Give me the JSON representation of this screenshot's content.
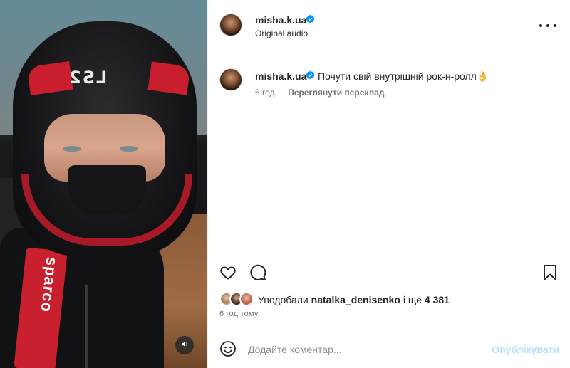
{
  "media": {
    "helmet_logo_text": "LS2",
    "strap_text": "sparco",
    "sound_icon": "speaker-icon"
  },
  "post": {
    "author": {
      "username": "misha.k.ua",
      "verified": true,
      "audio_label": "Original audio"
    },
    "caption": {
      "username": "misha.k.ua",
      "text": "Почути свій внутрішній рок-н-ролл👌",
      "time_ago": "6 год.",
      "translate_label": "Переглянути переклад"
    },
    "likes": {
      "prefix": "Уподобали ",
      "first_liker": "natalka_denisenko",
      "middle": " і ще ",
      "count": "4 381"
    },
    "timestamp": "6 год тому"
  },
  "comment_box": {
    "placeholder": "Додайте коментар...",
    "post_label": "Опублікувати"
  },
  "colors": {
    "verified_blue": "#0095f6",
    "post_button_disabled": "#b2dffc",
    "text_primary": "#262626",
    "text_secondary": "#737373",
    "divider": "#efefef"
  }
}
